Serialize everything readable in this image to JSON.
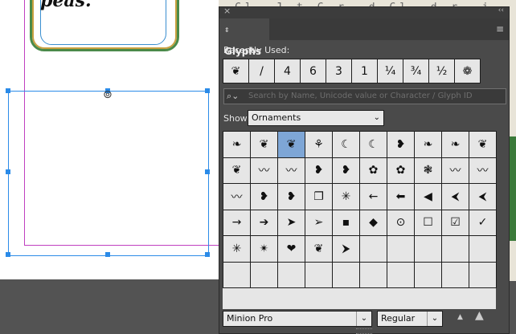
{
  "document": {
    "frame_text": "peas."
  },
  "background": {
    "strip_text": "Cl-  J.t  C.r..d  Cl..d.r..i"
  },
  "panel": {
    "title": "Glyphs",
    "close_glyph": "×",
    "collapse_glyph": "‹‹",
    "menu_glyph": "≡",
    "recently_used_label": "Recently Used:",
    "recently_used": [
      "❦",
      "/",
      "4",
      "6",
      "3",
      "1",
      "¼",
      "¾",
      "½",
      "❁"
    ],
    "search": {
      "icon": "⌕⌄",
      "placeholder": "Search by Name, Unicode value or Character / Glyph ID"
    },
    "show_label": "Show:",
    "show_value": "Ornaments",
    "glyphs": [
      [
        "❧",
        "❦",
        "❦",
        "⚘",
        "☾",
        "☾",
        "❥",
        "❧",
        "❧",
        "❦"
      ],
      [
        "❦",
        "〰",
        "〰",
        "❥",
        "❥",
        "✿",
        "✿",
        "❃",
        "〰",
        "〰"
      ],
      [
        "〰",
        "❥",
        "❥",
        "❐",
        "✳",
        "←",
        "⬅",
        "◀",
        "⮜",
        "⮜"
      ],
      [
        "→",
        "➔",
        "➤",
        "➢",
        "▪",
        "◆",
        "⊙",
        "☐",
        "☑",
        "✓"
      ],
      [
        "✳",
        "✴",
        "❤",
        "❦",
        "⮞",
        "",
        "",
        "",
        "",
        ""
      ],
      [
        "",
        "",
        "",
        "",
        "",
        "",
        "",
        "",
        "",
        ""
      ]
    ],
    "selected_glyph_index": 2,
    "font_family": "Minion Pro",
    "font_style": "Regular",
    "dropdown_glyph": "⌄",
    "zoom_out_glyph": "▲",
    "zoom_in_glyph": "▲"
  }
}
